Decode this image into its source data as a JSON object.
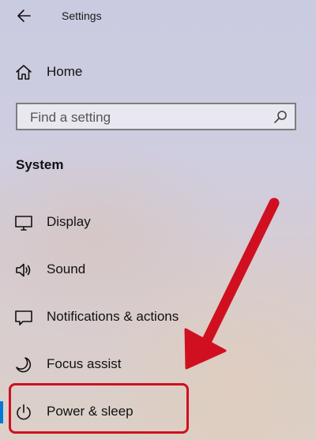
{
  "header": {
    "title": "Settings",
    "back_icon": "arrow-left-icon"
  },
  "home": {
    "label": "Home",
    "icon": "home-icon"
  },
  "search": {
    "placeholder": "Find a setting",
    "value": "",
    "icon": "search-icon"
  },
  "section": {
    "title": "System"
  },
  "items": [
    {
      "label": "Display",
      "icon": "display-icon"
    },
    {
      "label": "Sound",
      "icon": "speaker-icon"
    },
    {
      "label": "Notifications & actions",
      "icon": "notification-icon"
    },
    {
      "label": "Focus assist",
      "icon": "moon-icon"
    },
    {
      "label": "Power & sleep",
      "icon": "power-icon",
      "selected": true
    }
  ],
  "colors": {
    "accent": "#0078d7",
    "annotation": "#d01020"
  }
}
